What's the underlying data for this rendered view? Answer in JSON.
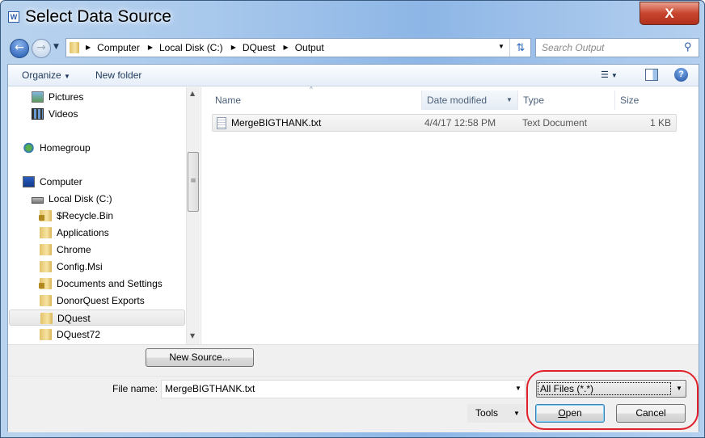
{
  "window": {
    "title": "Select Data Source",
    "app_icon": "word-icon",
    "close_label": "X"
  },
  "address": {
    "segments": [
      "Computer",
      "Local Disk (C:)",
      "DQuest",
      "Output"
    ],
    "search_placeholder": "Search Output"
  },
  "toolbar": {
    "organize": "Organize",
    "new_folder": "New folder"
  },
  "tree": {
    "items": [
      {
        "label": "Pictures",
        "icon": "pictures-icon"
      },
      {
        "label": "Videos",
        "icon": "videos-icon"
      },
      {
        "label": "Homegroup",
        "icon": "homegroup-icon"
      },
      {
        "label": "Computer",
        "icon": "computer-icon"
      },
      {
        "label": "Local Disk (C:)",
        "icon": "drive-icon"
      },
      {
        "label": "$Recycle.Bin",
        "icon": "locked-folder-icon"
      },
      {
        "label": "Applications",
        "icon": "folder-icon"
      },
      {
        "label": "Chrome",
        "icon": "folder-icon"
      },
      {
        "label": "Config.Msi",
        "icon": "folder-icon"
      },
      {
        "label": "Documents and Settings",
        "icon": "locked-folder-icon"
      },
      {
        "label": "DonorQuest Exports",
        "icon": "folder-icon"
      },
      {
        "label": "DQuest",
        "icon": "folder-icon",
        "selected": true
      },
      {
        "label": "DQuest72",
        "icon": "folder-icon"
      }
    ]
  },
  "files": {
    "columns": [
      "Name",
      "Date modified",
      "Type",
      "Size"
    ],
    "rows": [
      {
        "name": "MergeBIGTHANK.txt",
        "date": "4/4/17 12:58 PM",
        "type": "Text Document",
        "size": "1 KB"
      }
    ]
  },
  "bottom": {
    "new_source": "New Source...",
    "file_name_label": "File name:",
    "file_name_value": "MergeBIGTHANK.txt",
    "file_type": "All Files (*.*)",
    "tools": "Tools",
    "open": "Open",
    "cancel": "Cancel"
  },
  "colors": {
    "highlight_ring": "#e0202a"
  }
}
